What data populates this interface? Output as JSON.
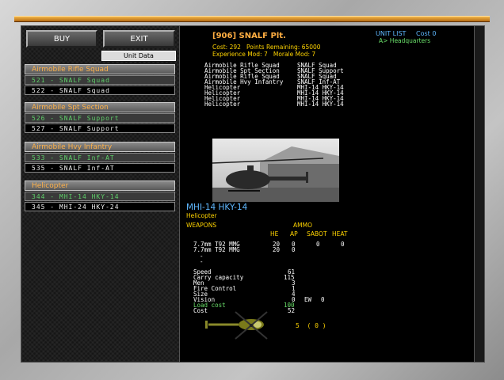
{
  "buttons": {
    "buy": "BUY",
    "exit": "EXIT",
    "unit_data": "Unit Data"
  },
  "groups": [
    {
      "title": "Airmobile Rifle Squad",
      "rows": [
        {
          "label": "521 - SNALF Squad",
          "selected": true
        },
        {
          "label": "522 - SNALF Squad",
          "selected": false
        }
      ]
    },
    {
      "title": "Airmobile Spt Section",
      "rows": [
        {
          "label": "526 - SNALF Support",
          "selected": true
        },
        {
          "label": "527 - SNALF Support",
          "selected": false
        }
      ]
    },
    {
      "title": "Airmobile Hvy Infantry",
      "rows": [
        {
          "label": "533 - SNALF Inf-AT",
          "selected": true
        },
        {
          "label": "535 - SNALF Inf-AT",
          "selected": false
        }
      ]
    },
    {
      "title": "Helicopter",
      "rows": [
        {
          "label": "344 - MHI-14 HKY-14",
          "selected": true
        },
        {
          "label": "345 - MHI-24 HKY-24",
          "selected": false
        }
      ]
    }
  ],
  "header": {
    "platoon": "[906] SNALF Plt.",
    "cost_line": "Cost: 292   Points Remaining: 65000",
    "mod_line": "Experience Mod: 7   Morale Mod: 7",
    "unit_list": "UNIT LIST",
    "unit_cost": "Cost 0",
    "hq": "A> Headquarters"
  },
  "composition": [
    {
      "type": "Airmobile Rifle Squad",
      "unit": "SNALF Squad"
    },
    {
      "type": "Airmobile Spt Section",
      "unit": "SNALF Support"
    },
    {
      "type": "Airmobile Rifle Squad",
      "unit": "SNALF Squad"
    },
    {
      "type": "Airmobile Hvy Infantry",
      "unit": "SNALF Inf-AT"
    },
    {
      "type": "Helicopter",
      "unit": "MHI-14 HKY-14"
    },
    {
      "type": "Helicopter",
      "unit": "MHI-14 HKY-14"
    },
    {
      "type": "Helicopter",
      "unit": "MHI-14 HKY-14"
    },
    {
      "type": "Helicopter",
      "unit": "MHI-14 HKY-14"
    }
  ],
  "unit": {
    "name": "MHI-14 HKY-14",
    "class": "Helicopter",
    "weapons_label": "WEAPONS",
    "ammo_label": "AMMO",
    "cols": [
      "HE",
      "AP",
      "SABOT",
      "HEAT"
    ],
    "weapons": [
      {
        "name": "7.7mm T92 MMG",
        "he": "20",
        "ap": "0",
        "sabot": "0",
        "heat": "0"
      },
      {
        "name": "7.7mm T92 MMG",
        "he": "20",
        "ap": "0",
        "sabot": "",
        "heat": ""
      },
      {
        "name": "-",
        "he": "",
        "ap": "",
        "sabot": "",
        "heat": ""
      },
      {
        "name": "-",
        "he": "",
        "ap": "",
        "sabot": "",
        "heat": ""
      }
    ],
    "stats": [
      {
        "label": "Speed",
        "value": "61"
      },
      {
        "label": "Carry capacity",
        "value": "115"
      },
      {
        "label": "Men",
        "value": "3"
      },
      {
        "label": "Fire Control",
        "value": "1"
      },
      {
        "label": "Size",
        "value": "4"
      },
      {
        "label": "Vision",
        "value": "0"
      }
    ],
    "ew_label": "EW",
    "ew_value": "0",
    "load_cost_label": "Load cost",
    "load_cost_value": "100",
    "cost_label": "Cost",
    "cost_value": "52",
    "count": "5  ( 0 )"
  }
}
